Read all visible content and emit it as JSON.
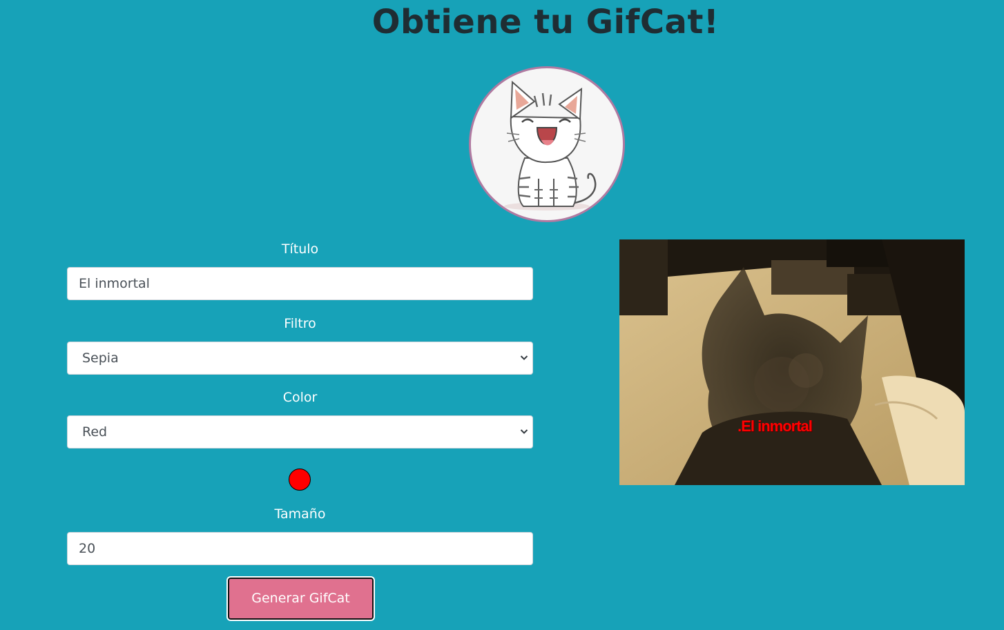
{
  "header": {
    "title": "Obtiene tu GifCat!"
  },
  "form": {
    "title_label": "Título",
    "title_value": "El inmortal",
    "filter_label": "Filtro",
    "filter_value": "Sepia",
    "color_label": "Color",
    "color_value": "Red",
    "color_swatch": "#ff0000",
    "size_label": "Tamaño",
    "size_value": "20",
    "generate_label": "Generar GifCat"
  },
  "preview": {
    "overlay_text": ".El inmortal"
  },
  "colors": {
    "background": "#17a2b8",
    "button": "#e0718f",
    "avatar_border": "#b07aa1"
  },
  "icons": {
    "avatar": "cartoon-cat-icon",
    "select_arrow": "chevron-down-icon"
  }
}
